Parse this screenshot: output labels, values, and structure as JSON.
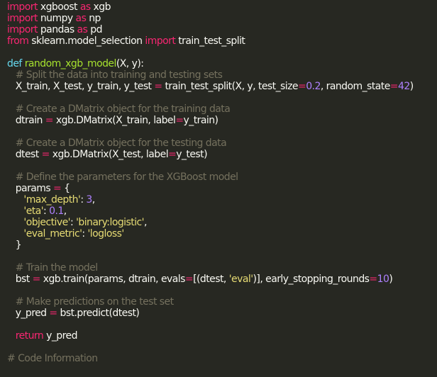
{
  "editor": {
    "theme": {
      "background": "#272822",
      "text": "#f8f8f2",
      "keyword": "#f92672",
      "definition": "#66d9ef",
      "function": "#a6e22e",
      "string": "#e6db74",
      "number": "#ae81ff",
      "comment": "#75715e"
    },
    "lines": [
      [
        [
          "kw",
          "import"
        ],
        [
          "pl",
          " xgboost "
        ],
        [
          "kw",
          "as"
        ],
        [
          "pl",
          " xgb"
        ]
      ],
      [
        [
          "kw",
          "import"
        ],
        [
          "pl",
          " numpy "
        ],
        [
          "kw",
          "as"
        ],
        [
          "pl",
          " np"
        ]
      ],
      [
        [
          "kw",
          "import"
        ],
        [
          "pl",
          " pandas "
        ],
        [
          "kw",
          "as"
        ],
        [
          "pl",
          " pd"
        ]
      ],
      [
        [
          "kw",
          "from"
        ],
        [
          "pl",
          " sklearn.model_selection "
        ],
        [
          "kw",
          "import"
        ],
        [
          "pl",
          " train_test_split"
        ]
      ],
      [],
      [
        [
          "def",
          "def"
        ],
        [
          "pl",
          " "
        ],
        [
          "fn",
          "random_xgb_model"
        ],
        [
          "pl",
          "(X, y):"
        ]
      ],
      [
        [
          "pl",
          "   "
        ],
        [
          "cm",
          "# Split the data into training and testing sets"
        ]
      ],
      [
        [
          "pl",
          "   X_train, X_test, y_train, y_test "
        ],
        [
          "op",
          "="
        ],
        [
          "pl",
          " train_test_split(X, y, test_size"
        ],
        [
          "op",
          "="
        ],
        [
          "num",
          "0.2"
        ],
        [
          "pl",
          ", random_state"
        ],
        [
          "op",
          "="
        ],
        [
          "num",
          "42"
        ],
        [
          "pl",
          ")"
        ]
      ],
      [],
      [
        [
          "pl",
          "   "
        ],
        [
          "cm",
          "# Create a DMatrix object for the training data"
        ]
      ],
      [
        [
          "pl",
          "   dtrain "
        ],
        [
          "op",
          "="
        ],
        [
          "pl",
          " xgb.DMatrix(X_train, label"
        ],
        [
          "op",
          "="
        ],
        [
          "pl",
          "y_train)"
        ]
      ],
      [],
      [
        [
          "pl",
          "   "
        ],
        [
          "cm",
          "# Create a DMatrix object for the testing data"
        ]
      ],
      [
        [
          "pl",
          "   dtest "
        ],
        [
          "op",
          "="
        ],
        [
          "pl",
          " xgb.DMatrix(X_test, label"
        ],
        [
          "op",
          "="
        ],
        [
          "pl",
          "y_test)"
        ]
      ],
      [],
      [
        [
          "pl",
          "   "
        ],
        [
          "cm",
          "# Define the parameters for the XGBoost model"
        ]
      ],
      [
        [
          "pl",
          "   params "
        ],
        [
          "op",
          "="
        ],
        [
          "pl",
          " {"
        ]
      ],
      [
        [
          "pl",
          "      "
        ],
        [
          "str",
          "'max_depth'"
        ],
        [
          "pl",
          ": "
        ],
        [
          "num",
          "3"
        ],
        [
          "pl",
          ","
        ]
      ],
      [
        [
          "pl",
          "      "
        ],
        [
          "str",
          "'eta'"
        ],
        [
          "pl",
          ": "
        ],
        [
          "num",
          "0.1"
        ],
        [
          "pl",
          ","
        ]
      ],
      [
        [
          "pl",
          "      "
        ],
        [
          "str",
          "'objective'"
        ],
        [
          "pl",
          ": "
        ],
        [
          "str",
          "'binary:logistic'"
        ],
        [
          "pl",
          ","
        ]
      ],
      [
        [
          "pl",
          "      "
        ],
        [
          "str",
          "'eval_metric'"
        ],
        [
          "pl",
          ": "
        ],
        [
          "str",
          "'logloss'"
        ]
      ],
      [
        [
          "pl",
          "   }"
        ]
      ],
      [],
      [
        [
          "pl",
          "   "
        ],
        [
          "cm",
          "# Train the model"
        ]
      ],
      [
        [
          "pl",
          "   bst "
        ],
        [
          "op",
          "="
        ],
        [
          "pl",
          " xgb.train(params, dtrain, evals"
        ],
        [
          "op",
          "="
        ],
        [
          "pl",
          "[(dtest, "
        ],
        [
          "str",
          "'eval'"
        ],
        [
          "pl",
          ")], early_stopping_rounds"
        ],
        [
          "op",
          "="
        ],
        [
          "num",
          "10"
        ],
        [
          "pl",
          ")"
        ]
      ],
      [],
      [
        [
          "pl",
          "   "
        ],
        [
          "cm",
          "# Make predictions on the test set"
        ]
      ],
      [
        [
          "pl",
          "   y_pred "
        ],
        [
          "op",
          "="
        ],
        [
          "pl",
          " bst.predict(dtest)"
        ]
      ],
      [],
      [
        [
          "pl",
          "   "
        ],
        [
          "kw",
          "return"
        ],
        [
          "pl",
          " y_pred"
        ]
      ],
      [],
      [
        [
          "cm",
          "# Code Information"
        ]
      ]
    ]
  }
}
